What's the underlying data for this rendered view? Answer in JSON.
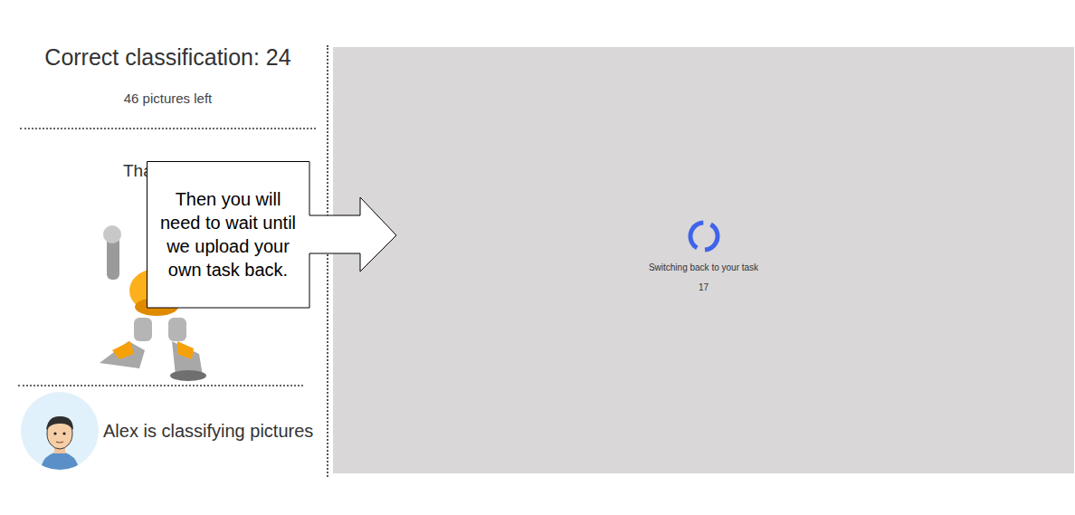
{
  "score": {
    "label": "Correct classification: 24",
    "pictures_left": "46 pictures left"
  },
  "message": "Tha",
  "callout": {
    "text": "Then you will need to wait until we upload your own task back."
  },
  "partner": {
    "status": "Alex is classifying pictures"
  },
  "loading": {
    "text": "Switching back to your task",
    "countdown": "17"
  }
}
